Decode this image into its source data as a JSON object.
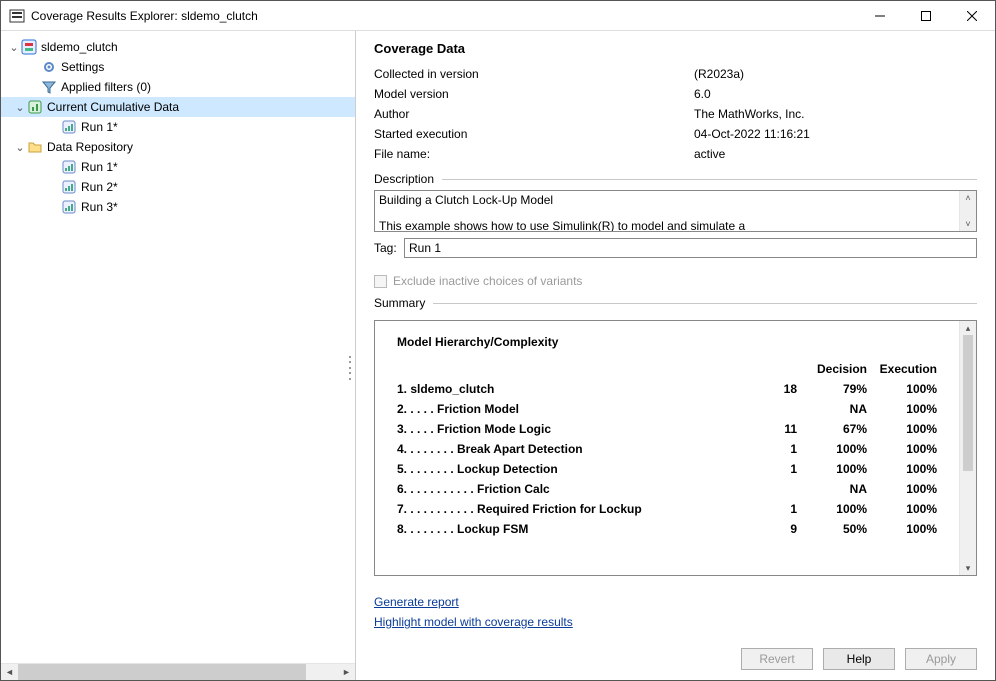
{
  "window": {
    "title": "Coverage Results Explorer: sldemo_clutch"
  },
  "tree": {
    "root": "sldemo_clutch",
    "settings": "Settings",
    "applied_filters": "Applied filters (0)",
    "current_cumulative": "Current Cumulative Data",
    "ccd_run1": "Run 1*",
    "data_repository": "Data Repository",
    "dr_run1": "Run 1*",
    "dr_run2": "Run 2*",
    "dr_run3": "Run 3*"
  },
  "panel": {
    "title": "Coverage Data",
    "collected_label": "Collected in version",
    "collected_value": "(R2023a)",
    "model_version_label": "Model version",
    "model_version_value": "6.0",
    "author_label": "Author",
    "author_value": "The MathWorks, Inc.",
    "started_label": "Started execution",
    "started_value": "04-Oct-2022 11:16:21",
    "filename_label": "File name:",
    "filename_value": "active",
    "description_label": "Description",
    "description_line1": "Building a Clutch Lock-Up Model",
    "description_line2": "This example shows how to use Simulink(R) to model and simulate a",
    "tag_label": "Tag:",
    "tag_value": "Run 1",
    "exclude_label": "Exclude inactive choices of variants",
    "summary_label": "Summary",
    "summary_title": "Model Hierarchy/Complexity",
    "col_decision": "Decision",
    "col_execution": "Execution",
    "generate_report": "Generate report",
    "highlight": "Highlight model with coverage results",
    "revert": "Revert",
    "help": "Help",
    "apply": "Apply"
  },
  "summary_rows": [
    {
      "name": "1. sldemo_clutch",
      "cx": "18",
      "dec": "79%",
      "exec": "100%"
    },
    {
      "name": "2. . . . . Friction Model",
      "cx": "",
      "dec": "NA",
      "exec": "100%"
    },
    {
      "name": "3. . . . . Friction Mode Logic",
      "cx": "11",
      "dec": "67%",
      "exec": "100%"
    },
    {
      "name": "4. . . . . . . . Break Apart Detection",
      "cx": "1",
      "dec": "100%",
      "exec": "100%"
    },
    {
      "name": "5. . . . . . . . Lockup Detection",
      "cx": "1",
      "dec": "100%",
      "exec": "100%"
    },
    {
      "name": "6. . . . . . . . . . . Friction Calc",
      "cx": "",
      "dec": "NA",
      "exec": "100%"
    },
    {
      "name": "7. . . . . . . . . . . Required Friction for Lockup",
      "cx": "1",
      "dec": "100%",
      "exec": "100%"
    },
    {
      "name": "8. . . . . . . . Lockup FSM",
      "cx": "9",
      "dec": "50%",
      "exec": "100%"
    }
  ]
}
